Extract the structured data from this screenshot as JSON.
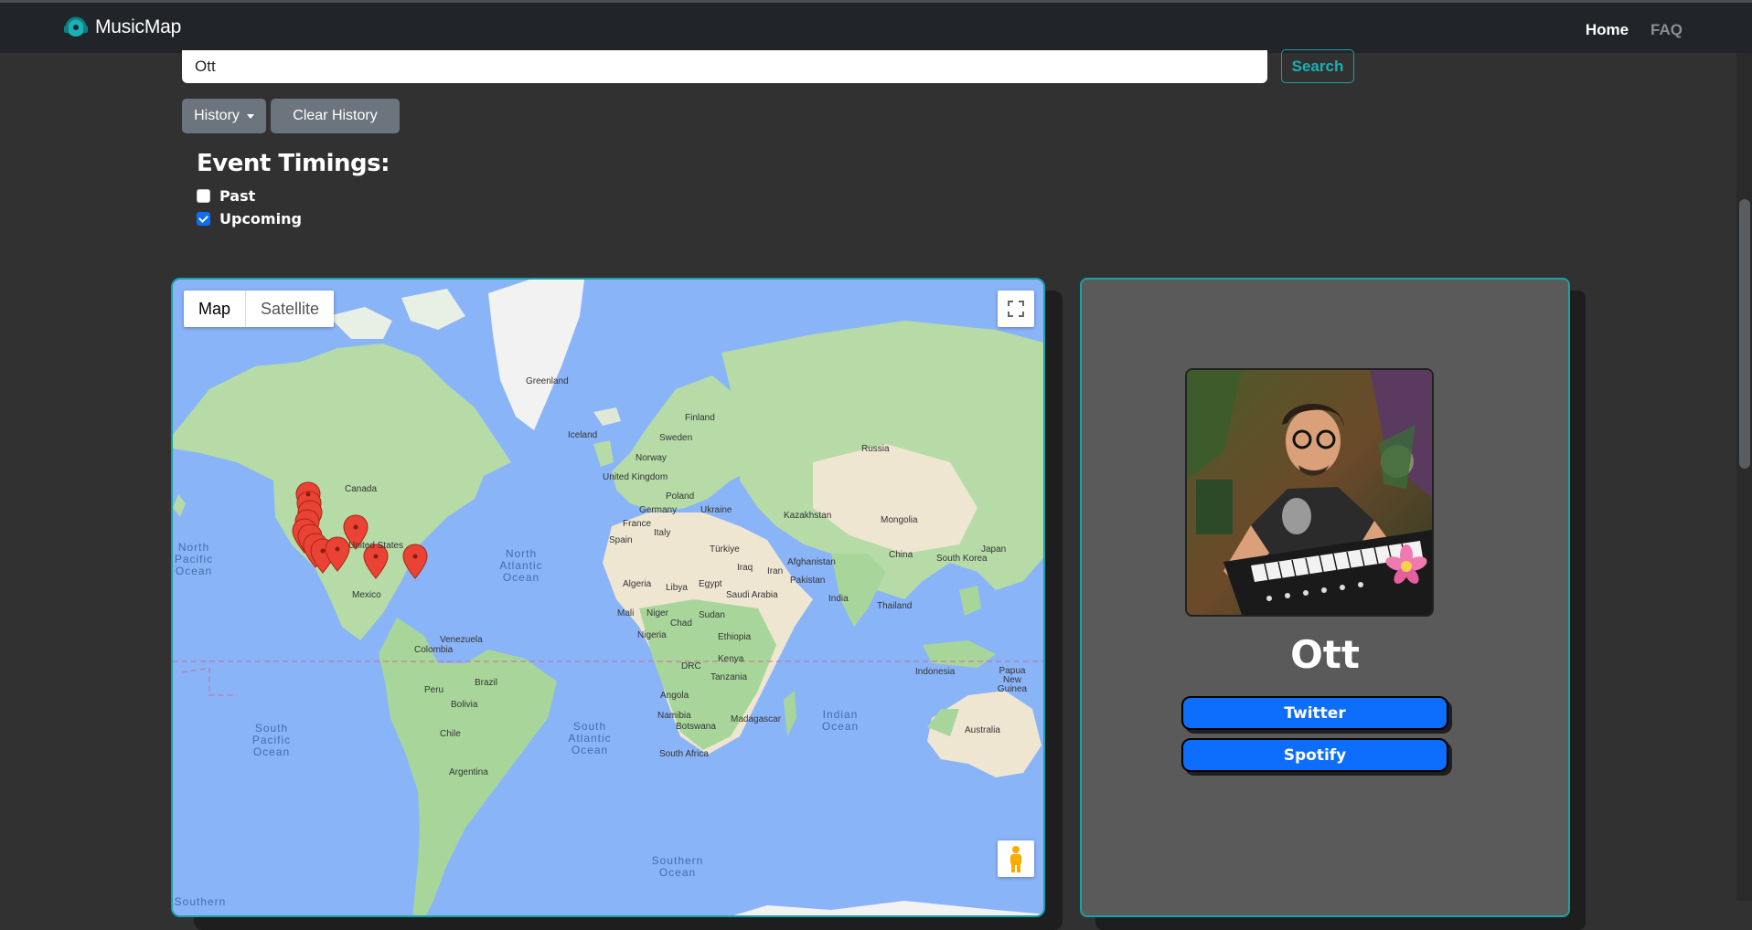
{
  "navbar": {
    "brand": "MusicMap",
    "links": {
      "home": "Home",
      "faq": "FAQ"
    }
  },
  "search": {
    "value": "Ott",
    "button": "Search"
  },
  "history": {
    "dropdown_label": "History",
    "clear_label": "Clear History"
  },
  "event_timings": {
    "title": "Event Timings:",
    "options": [
      {
        "label": "Past",
        "checked": false
      },
      {
        "label": "Upcoming",
        "checked": true
      }
    ]
  },
  "map": {
    "type_options": [
      "Map",
      "Satellite"
    ],
    "selected_type": "Map",
    "place_labels": [
      "Greenland",
      "Iceland",
      "Finland",
      "Sweden",
      "Norway",
      "Russia",
      "United Kingdom",
      "Poland",
      "Germany",
      "Ukraine",
      "France",
      "Spain",
      "Italy",
      "Kazakhstan",
      "Mongolia",
      "Türkiye",
      "Iraq",
      "Iran",
      "Afghanistan",
      "Pakistan",
      "China",
      "South Korea",
      "Japan",
      "India",
      "Thailand",
      "Saudi Arabia",
      "Egypt",
      "Algeria",
      "Libya",
      "Mali",
      "Niger",
      "Chad",
      "Sudan",
      "Nigeria",
      "Ethiopia",
      "DRC",
      "Kenya",
      "Tanzania",
      "Angola",
      "Namibia",
      "Botswana",
      "South Africa",
      "Madagascar",
      "Indonesia",
      "Papua New Guinea",
      "Australia",
      "Canada",
      "United States",
      "Mexico",
      "Venezuela",
      "Colombia",
      "Peru",
      "Brazil",
      "Bolivia",
      "Chile",
      "Argentina"
    ],
    "ocean_labels": [
      "North Pacific Ocean",
      "North Atlantic Ocean",
      "South Pacific Ocean",
      "South Atlantic Ocean",
      "Indian Ocean",
      "Southern Ocean",
      "Southern"
    ],
    "marker_count": 14
  },
  "artist": {
    "name": "Ott",
    "links": {
      "twitter": "Twitter",
      "spotify": "Spotify"
    }
  },
  "colors": {
    "accent": "#1aa1a6",
    "primary_button": "#0d6efd",
    "secondary_button": "#6c757d",
    "background": "#313131"
  }
}
